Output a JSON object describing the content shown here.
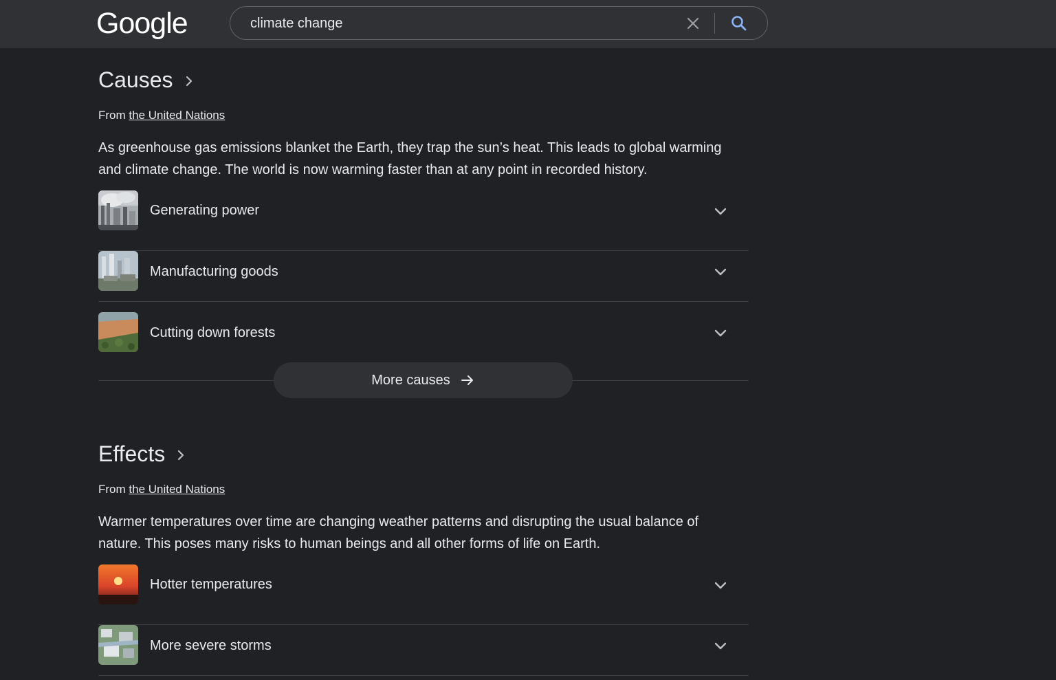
{
  "header": {
    "logo_text": "Google",
    "search_value": "climate change",
    "clear_icon": "close-icon",
    "search_icon": "search-icon"
  },
  "causes": {
    "title": "Causes",
    "source_prefix": "From ",
    "source_link": "the United Nations",
    "description": "As greenhouse gas emissions blanket the Earth, they trap the sun’s heat. This leads to global warming and climate change. The world is now warming faster than at any point in recorded history.",
    "items": [
      {
        "label": "Generating power"
      },
      {
        "label": "Manufacturing goods"
      },
      {
        "label": "Cutting down forests"
      }
    ],
    "more_label": "More causes"
  },
  "effects": {
    "title": "Effects",
    "source_prefix": "From ",
    "source_link": "the United Nations",
    "description": "Warmer temperatures over time are changing weather patterns and disrupting the usual balance of nature. This poses many risks to human beings and all other forms of life on Earth.",
    "items": [
      {
        "label": "Hotter temperatures"
      },
      {
        "label": "More severe storms"
      }
    ]
  },
  "colors": {
    "background": "#202124",
    "header": "#303134",
    "text": "#e8eaed",
    "divider": "#3c4043",
    "search_icon": "#8ab4f8"
  }
}
